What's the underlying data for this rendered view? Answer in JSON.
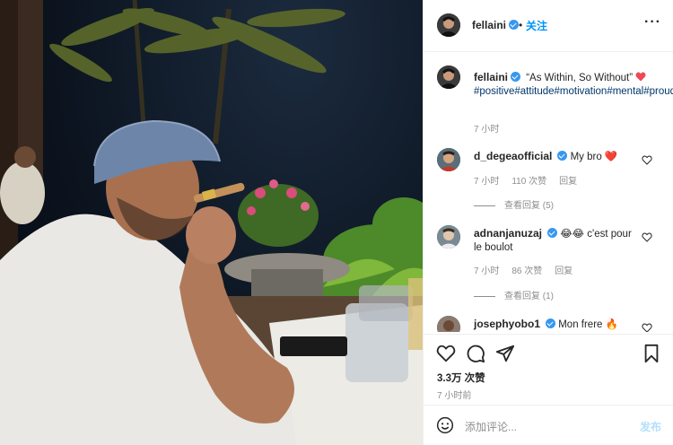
{
  "header": {
    "username": "fellaini",
    "separator": "•",
    "follow_label": "关注",
    "more_icon": "more-horizontal-icon"
  },
  "caption": {
    "username": "fellaini",
    "text": "“As Within, So Without”",
    "hashtags": "#positive#attitude#motivation#mental#proud#hard#work#love#peace#",
    "time": "7 小时"
  },
  "comments": [
    {
      "username": "d_degeaofficial",
      "text": "My bro",
      "emoji": "❤️",
      "time": "7 小时",
      "likes": "110 次赞",
      "reply_label": "回复",
      "view_replies": "查看回复 (5)"
    },
    {
      "username": "adnanjanuzaj",
      "text": "😂😂 c'est pour le boulot",
      "time": "7 小时",
      "likes": "86 次赞",
      "reply_label": "回复",
      "view_replies": "查看回复 (1)"
    },
    {
      "username": "josephyobo1",
      "text": "Mon frere 🔥"
    }
  ],
  "actions": {
    "likes": "3.3万 次赞",
    "time": "7 小时前"
  },
  "add_comment": {
    "placeholder": "添加评论...",
    "post_label": "发布"
  },
  "colors": {
    "link_blue": "#0095f6",
    "hashtag": "#00376b",
    "muted": "#8e8e8e",
    "verified": "#3897f0",
    "heart_red": "#ed4956"
  }
}
